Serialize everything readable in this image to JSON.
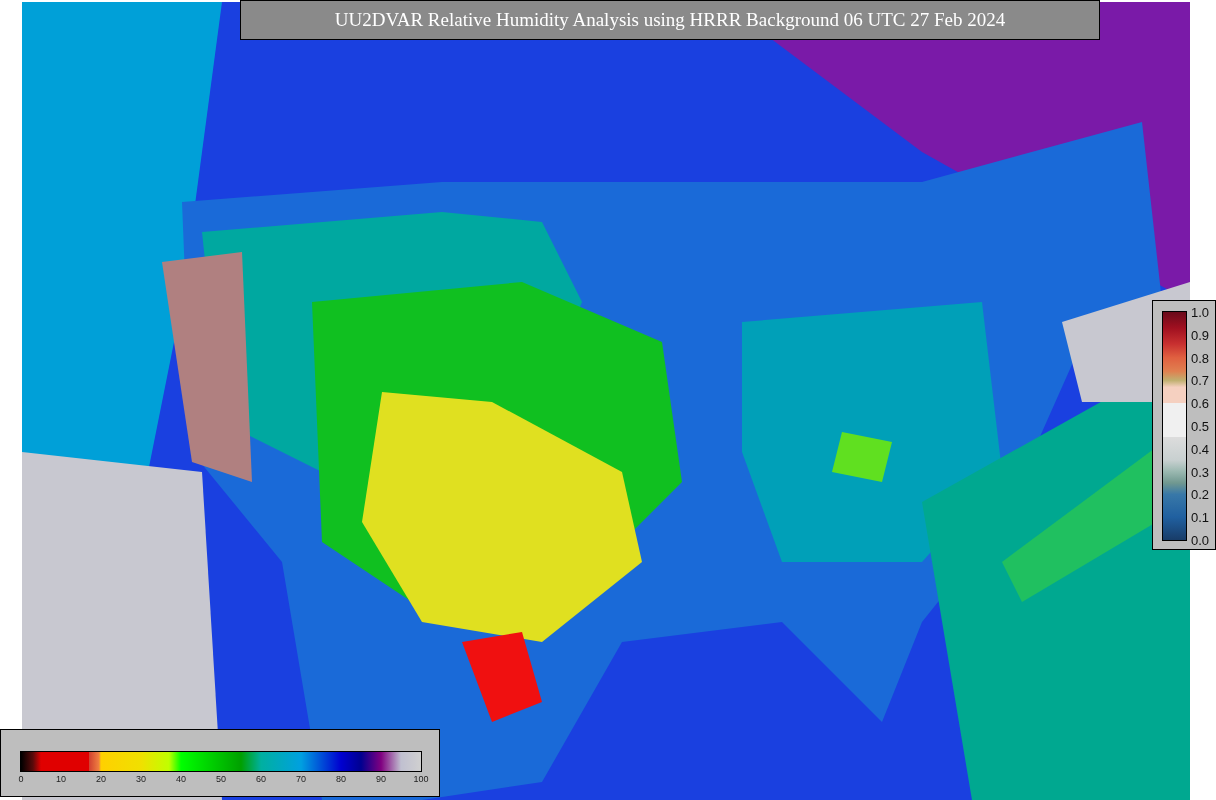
{
  "title": "UU2DVAR Relative Humidity Analysis using HRRR Background 06 UTC 27 Feb 2024",
  "humidity_colorbar": {
    "ticks": [
      "0",
      "10",
      "20",
      "30",
      "40",
      "50",
      "60",
      "70",
      "80",
      "90",
      "100"
    ]
  },
  "observation_colorbar": {
    "ticks": [
      "1.0",
      "0.9",
      "0.8",
      "0.7",
      "0.6",
      "0.5",
      "0.4",
      "0.3",
      "0.2",
      "0.1",
      "0.0"
    ]
  }
}
